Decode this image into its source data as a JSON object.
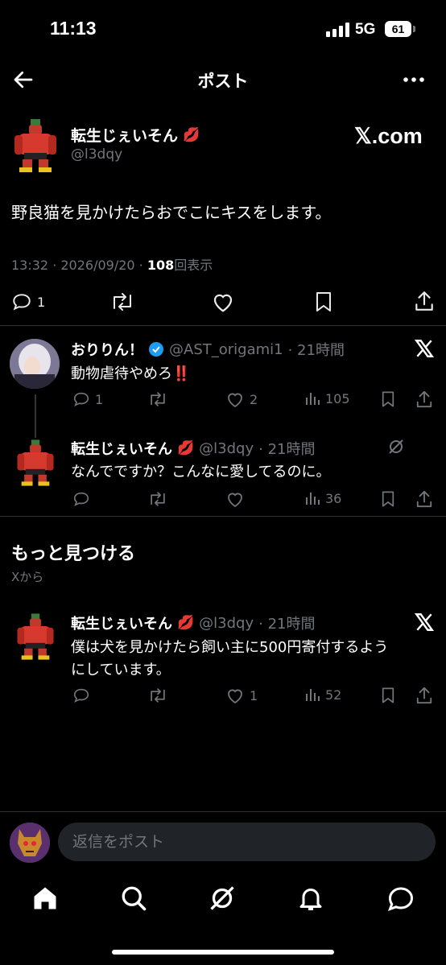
{
  "status_bar": {
    "time": "11:13",
    "network": "5G",
    "battery": "61"
  },
  "nav": {
    "title": "ポスト"
  },
  "main_post": {
    "name": "転生じぇいそん",
    "name_emoji": "💋",
    "handle": "@l3dqy",
    "source_badge": "𝕏.com",
    "text": "野良猫を見かけたらおでこにキスをします。",
    "timestamp": "13:32 · 2026/09/20 · ",
    "views_count": "108",
    "views_label": "回表示",
    "reply_count": "1"
  },
  "replies": [
    {
      "name": "おりりん！",
      "handle": "@AST_origami1",
      "time": "· 21時間",
      "text": "動物虐待やめろ‼️",
      "reply_count": "1",
      "like_count": "2",
      "view_count": "105"
    },
    {
      "name": "転生じぇいそん",
      "name_emoji": "💋",
      "handle": "@l3dqy",
      "time": "· 21時間",
      "text": "なんでですか？こんなに愛してるのに。",
      "view_count": "36"
    }
  ],
  "discover": {
    "title": "もっと見つける",
    "subtitle": "Xから",
    "post": {
      "name": "転生じぇいそん",
      "name_emoji": "💋",
      "handle": "@l3dqy",
      "time": "· 21時間",
      "text_line1": "僕は犬を見かけたら飼い主に500円寄付するよう",
      "text_line2": "にしています。",
      "like_count": "1",
      "view_count": "52"
    }
  },
  "reply_bar": {
    "placeholder": "返信をポスト"
  },
  "colors": {
    "background": "#000000",
    "muted": "#71767b",
    "verified": "#1d9bf0",
    "divider": "#2f3336"
  }
}
